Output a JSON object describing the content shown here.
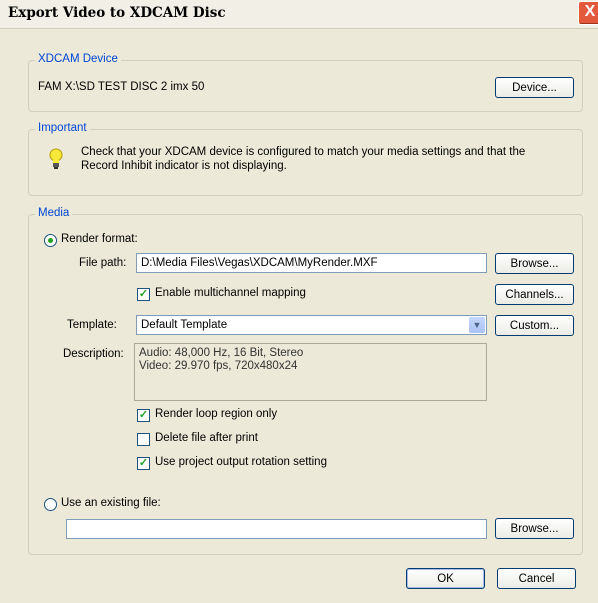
{
  "window": {
    "title": "Export Video to XDCAM Disc",
    "close_glyph": "X"
  },
  "device_group": {
    "legend": "XDCAM Device",
    "device_name": "FAM X:\\SD TEST DISC 2 imx 50",
    "device_button": "Device..."
  },
  "important_group": {
    "legend": "Important",
    "icon": "lightbulb-icon",
    "line1": "Check that your XDCAM device is configured to match your media settings and that the",
    "line2": "Record Inhibit indicator is not displaying."
  },
  "media_group": {
    "legend": "Media",
    "render_format_label": "Render format:",
    "render_format_selected": true,
    "file_path_label": "File path:",
    "file_path_value": "D:\\Media Files\\Vegas\\XDCAM\\MyRender.MXF",
    "browse_button": "Browse...",
    "multichannel_label": "Enable multichannel mapping",
    "multichannel_checked": true,
    "channels_button": "Channels...",
    "template_label": "Template:",
    "template_value": "Default Template",
    "custom_button": "Custom...",
    "description_label": "Description:",
    "description_line1": "Audio: 48,000 Hz, 16 Bit, Stereo",
    "description_line2": "Video: 29.970 fps, 720x480x24",
    "loop_region_label": "Render loop region only",
    "loop_region_checked": true,
    "delete_file_label": "Delete file after print",
    "delete_file_checked": false,
    "rotation_label": "Use project output rotation setting",
    "rotation_checked": true,
    "existing_file_label": "Use an existing file:",
    "existing_file_selected": false,
    "existing_file_value": "",
    "browse_button_2": "Browse..."
  },
  "footer": {
    "ok_button": "OK",
    "cancel_button": "Cancel"
  },
  "colors": {
    "accent": "#0046d5",
    "check": "#21a121",
    "window_bg": "#ece9d8"
  }
}
